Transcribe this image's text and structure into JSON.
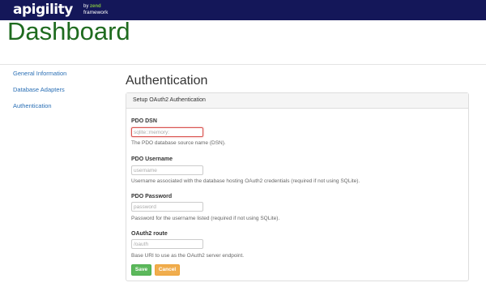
{
  "header": {
    "logo_main": "apigility",
    "logo_by": "by",
    "logo_zend": "zend",
    "logo_framework": "framework"
  },
  "page": {
    "title": "Dashboard"
  },
  "sidebar": {
    "items": [
      {
        "label": "General Information"
      },
      {
        "label": "Database Adapters"
      },
      {
        "label": "Authentication"
      }
    ]
  },
  "main": {
    "title": "Authentication",
    "panel_heading": "Setup OAuth2 Authentication",
    "fields": [
      {
        "label": "PDO DSN",
        "value": "",
        "placeholder": "sqlite::memory:",
        "help": "The PDO database source name (DSN)."
      },
      {
        "label": "PDO Username",
        "value": "",
        "placeholder": "username",
        "help": "Username associated with the database hosting OAuth2 credentials (required if not using SQLite)."
      },
      {
        "label": "PDO Password",
        "value": "",
        "placeholder": "password",
        "help": "Password for the username listed (required if not using SQLite)."
      },
      {
        "label": "OAuth2 route",
        "value": "",
        "placeholder": "/oauth",
        "help": "Base URI to use as the OAuth2 server endpoint."
      }
    ],
    "buttons": {
      "save": "Save",
      "cancel": "Cancel"
    }
  },
  "colors": {
    "topbar": "#141759",
    "title_green": "#1f6b1f",
    "link_blue": "#2a6fb5",
    "save_green": "#5cb85c",
    "cancel_orange": "#f0ad4e",
    "error_red": "#d9534f"
  }
}
